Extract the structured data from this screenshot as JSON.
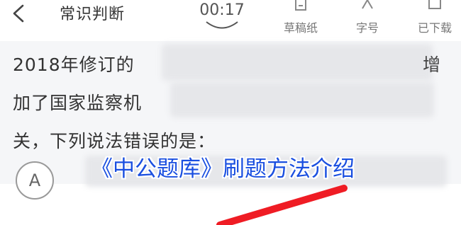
{
  "header": {
    "title": "常识判断",
    "timer": "00:17",
    "tools": [
      {
        "label": "草稿纸",
        "icon": "draft-paper-icon"
      },
      {
        "label": "字号",
        "icon": "font-size-icon"
      },
      {
        "label": "已下载",
        "icon": "downloaded-icon"
      }
    ]
  },
  "question": {
    "line1": "2018年修订的",
    "line2": "加了国家监察机",
    "line3": "关，下列说法错误的是：",
    "edge_char": "增"
  },
  "options": [
    {
      "label": "A"
    }
  ],
  "overlay": {
    "title": "《中公题库》刷题方法介绍"
  },
  "colors": {
    "overlay_text": "#1a4fe0",
    "arrow": "#ef1c24",
    "question_bg": "#f5f6f8"
  }
}
